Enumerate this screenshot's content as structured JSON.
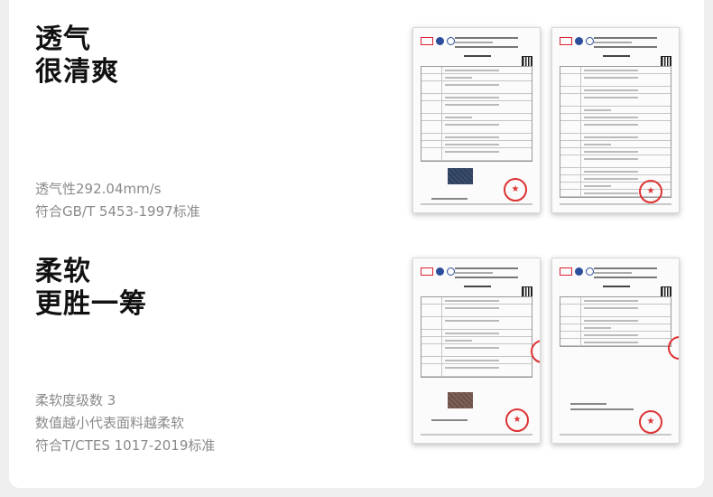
{
  "sections": [
    {
      "heading_line1": "透气",
      "heading_line2": "很清爽",
      "desc_lines": [
        "透气性292.04mm/s",
        "符合GB/T 5453-1997标准"
      ]
    },
    {
      "heading_line1": "柔软",
      "heading_line2": "更胜一筹",
      "desc_lines": [
        "柔软度级数  3",
        "数值越小代表面料越柔软",
        "符合T/CTES 1017-2019标准"
      ]
    }
  ],
  "colors": {
    "heading": "#111111",
    "description": "#8a8a8a",
    "stamp": "#dd3333",
    "swatch_navy": "#2d3f5a",
    "swatch_brown": "#6b5148"
  },
  "icons": {
    "stamp": "star-seal-icon",
    "logo": "cma-logo-icon"
  },
  "stamp_glyph": "★"
}
